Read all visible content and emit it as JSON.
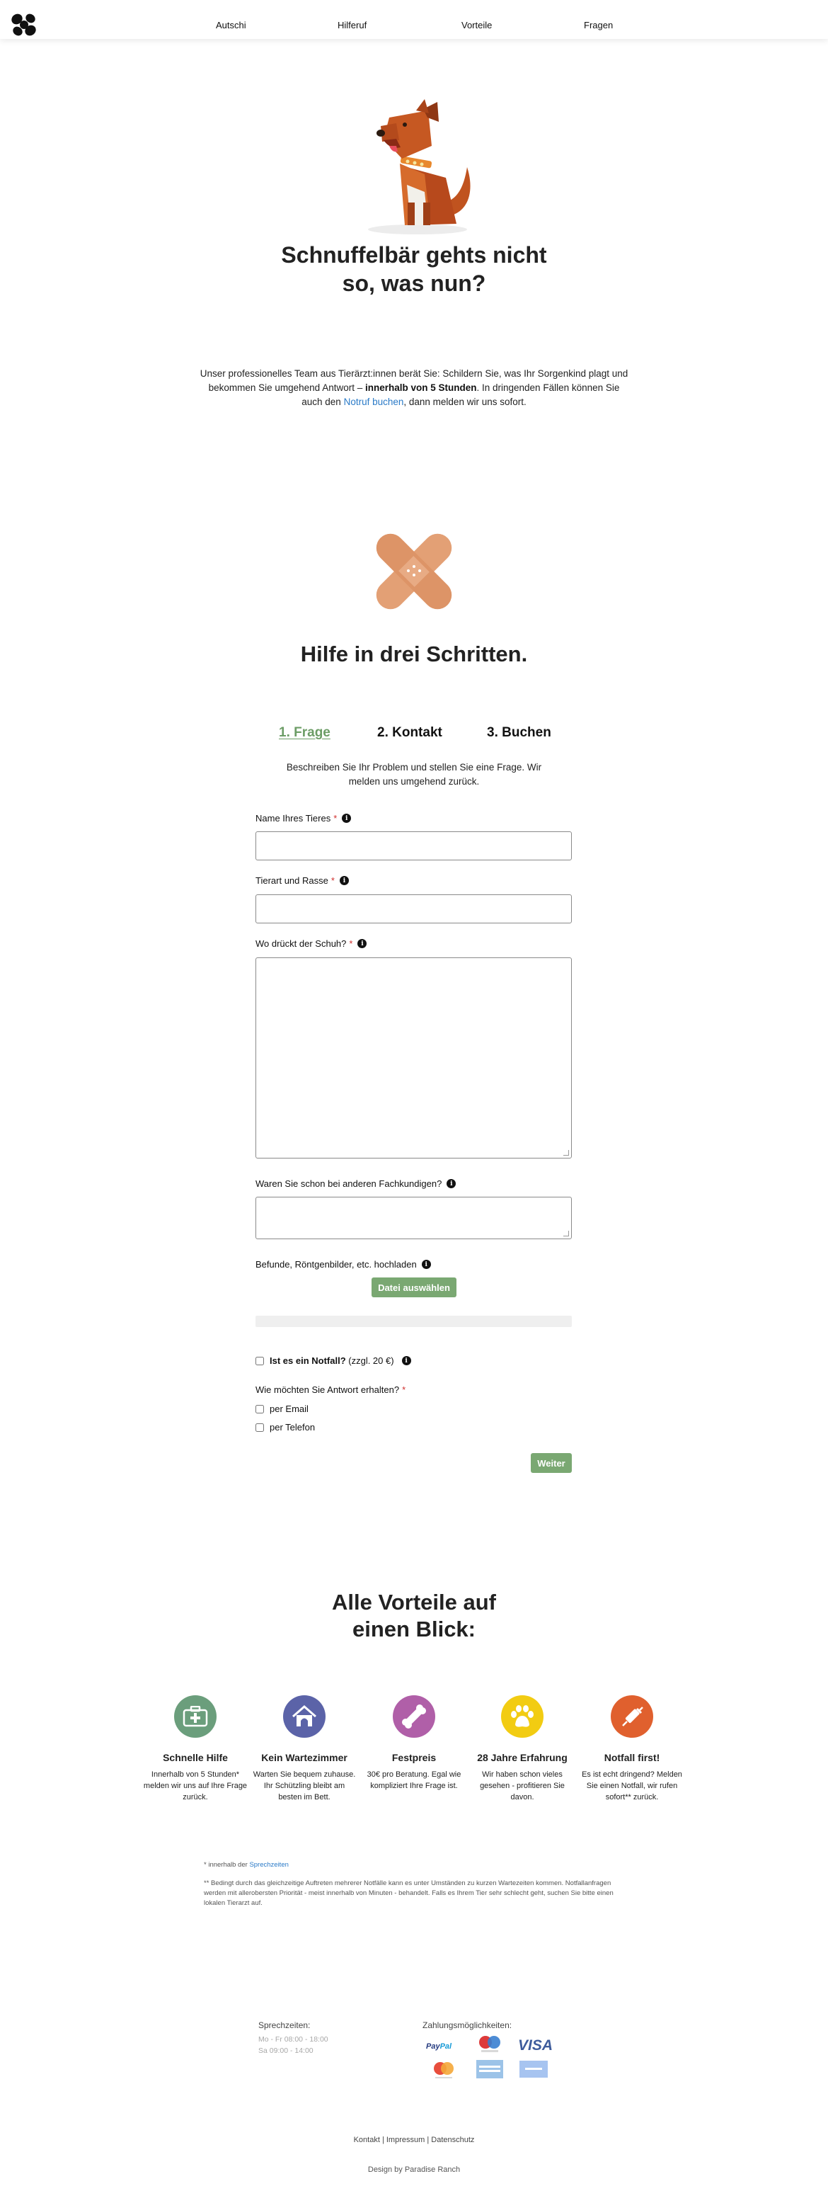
{
  "nav": {
    "links": [
      "Autschi",
      "Hilferuf",
      "Vorteile",
      "Fragen"
    ]
  },
  "hero": {
    "title_line1": "Schnuffelbär gehts nicht",
    "title_line2": "so, was nun?",
    "intro_part1": "Unser professionelles Team aus Tierärzt:innen berät Sie: Schildern Sie, was Ihr Sorgenkind plagt und bekommen Sie umgehend Antwort – ",
    "intro_bold": "innerhalb von 5 Stunden",
    "intro_part2": ". In dringenden Fällen können Sie auch den ",
    "intro_link": "Notruf buchen",
    "intro_part3": ", dann melden wir uns sofort."
  },
  "steps": {
    "title": "Hilfe in drei Schritten.",
    "tabs": [
      "1. Frage",
      "2. Kontakt",
      "3. Buchen"
    ],
    "active_tab": 0,
    "description": "Beschreiben Sie Ihr Problem und stellen Sie eine Frage. Wir melden uns umgehend zurück."
  },
  "form": {
    "pet_name_label": "Name Ihres Tieres",
    "species_label": "Tierart und Rasse",
    "problem_label": "Wo drückt der Schuh?",
    "other_vets_label": "Waren Sie schon bei anderen Fachkundigen?",
    "upload_label": "Befunde, Röntgenbilder, etc. hochladen",
    "upload_button": "Datei auswählen",
    "emergency_label": "Ist es ein Notfall?",
    "emergency_extra": "(zzgl. 20 €)",
    "reply_question": "Wie möchten Sie Antwort erhalten?",
    "reply_email": "per Email",
    "reply_phone": "per Telefon",
    "required_mark": "*",
    "next_button": "Weiter"
  },
  "advantages": {
    "title_line1": "Alle Vorteile auf",
    "title_line2": "einen Blick:",
    "items": [
      {
        "icon": "first-aid-kit-icon",
        "color": "#6b9e7c",
        "title": "Schnelle Hilfe",
        "desc": "Innerhalb von 5 Stunden* melden wir uns auf Ihre Frage zurück."
      },
      {
        "icon": "dog-house-icon",
        "color": "#5b63a8",
        "title": "Kein Wartezimmer",
        "desc": "Warten Sie bequem zuhause. Ihr Schützling bleibt am besten im Bett."
      },
      {
        "icon": "bone-icon",
        "color": "#b05fa8",
        "title": "Festpreis",
        "desc": "30€ pro Beratung. Egal wie kompliziert Ihre Frage ist."
      },
      {
        "icon": "paw-icon",
        "color": "#f2cc12",
        "title": "28 Jahre Erfahrung",
        "desc": "Wir haben schon vieles gesehen - profitieren Sie davon."
      },
      {
        "icon": "syringe-icon",
        "color": "#e0602e",
        "title": "Notfall first!",
        "desc": "Es ist echt dringend? Melden Sie einen Notfall, wir rufen sofort** zurück."
      }
    ]
  },
  "notes": {
    "note1_text": "* innerhalb der ",
    "note1_link": "Sprechzeiten",
    "note2": "** Bedingt durch das gleichzeitige Auftreten mehrerer Notfälle kann es unter Umständen zu kurzen Wartezeiten kommen. Notfallanfragen werden mit allerobersten Priorität - meist innerhalb von Minuten - behandelt. Falls es Ihrem Tier sehr schlecht geht, suchen Sie bitte einen lokalen Tierarzt auf."
  },
  "footer": {
    "hours_title": "Sprechzeiten:",
    "hours_line1": "Mo - Fr 08:00 - 18:00",
    "hours_line2": "Sa 09:00 - 14:00",
    "payment_title": "Zahlungsmöglichkeiten:",
    "payment_methods": [
      "PayPal",
      "Maestro",
      "VISA",
      "Mastercard",
      "American Express",
      "Vorkasse"
    ],
    "links": [
      "Kontakt",
      "Impressum",
      "Datenschutz"
    ],
    "separator": "|",
    "credit": "Design by Paradise Ranch"
  }
}
